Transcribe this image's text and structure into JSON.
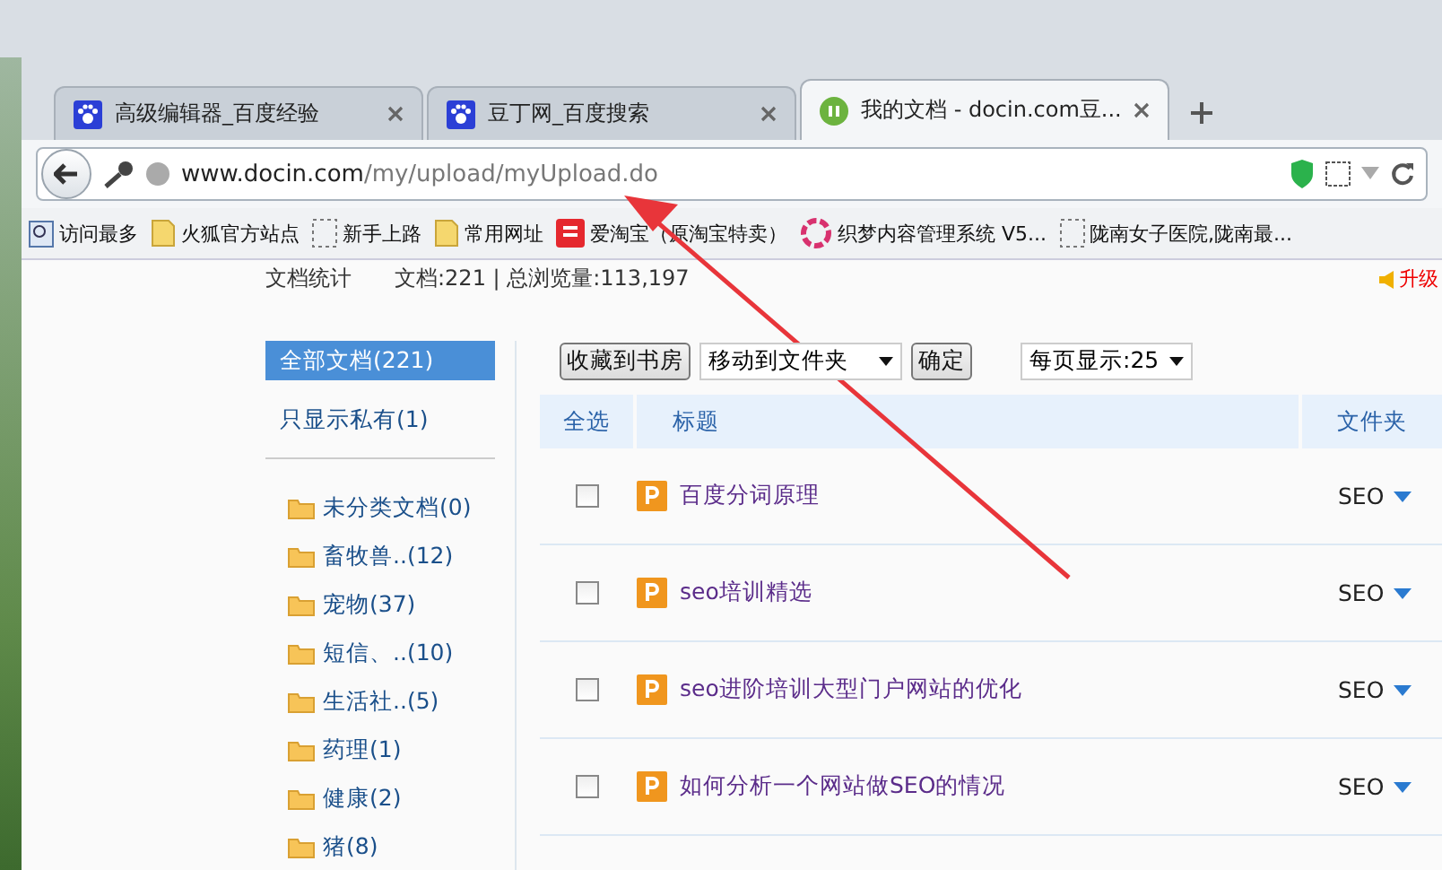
{
  "tabs": [
    {
      "title": "高级编辑器_百度经验",
      "kind": "paw",
      "selected": false
    },
    {
      "title": "豆丁网_百度搜索",
      "kind": "paw",
      "selected": false
    },
    {
      "title": "我的文档 - docin.com豆...",
      "kind": "docin",
      "selected": true
    }
  ],
  "address": {
    "host": "www.docin.com",
    "path": "/my/upload/myUpload.do"
  },
  "bookmarks": [
    {
      "label": "访问最多",
      "kind": "search"
    },
    {
      "label": "火狐官方站点",
      "kind": "folder"
    },
    {
      "label": "新手上路",
      "kind": "page"
    },
    {
      "label": "常用网址",
      "kind": "folder"
    },
    {
      "label": "爱淘宝（原淘宝特卖）",
      "kind": "taobao"
    },
    {
      "label": "织梦内容管理系统 V5...",
      "kind": "flower"
    },
    {
      "label": "陇南女子医院,陇南最...",
      "kind": "page"
    }
  ],
  "stats": {
    "label": "文档统计",
    "text": "文档:221 | 总浏览量:113,197"
  },
  "upgrade": "升级",
  "filters": [
    {
      "label": "全部文档(221)",
      "selected": true
    },
    {
      "label": "只显示私有(1)",
      "selected": false
    }
  ],
  "folders": [
    "未分类文档(0)",
    "畜牧兽..(12)",
    "宠物(37)",
    "短信、..(10)",
    "生活社..(5)",
    "药理(1)",
    "健康(2)",
    "猪(8)"
  ],
  "toolbar": {
    "collect_button": "收藏到书房",
    "move_select": "移动到文件夹",
    "confirm_button": "确定",
    "page_size": "每页显示:25"
  },
  "table": {
    "columns": [
      "全选",
      "标题",
      "文件夹"
    ],
    "rows": [
      {
        "title": "百度分词原理",
        "folder": "SEO",
        "checked": false
      },
      {
        "title": "seo培训精选",
        "folder": "SEO",
        "checked": false
      },
      {
        "title": "seo进阶培训大型门户网站的优化",
        "folder": "SEO",
        "checked": false
      },
      {
        "title": "如何分析一个网站做SEO的情况",
        "folder": "SEO",
        "checked": false
      }
    ]
  }
}
